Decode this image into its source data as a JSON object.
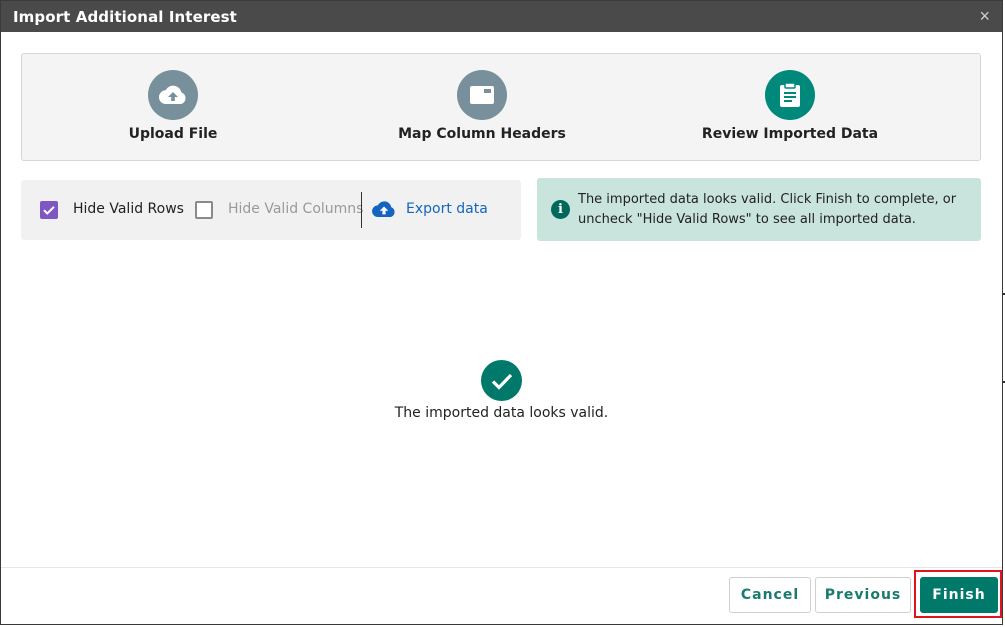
{
  "dialog": {
    "title": "Import Additional Interest",
    "close_label": "×"
  },
  "steps": [
    {
      "label": "Upload File",
      "icon": "cloud-upload-icon",
      "color": "#78909c"
    },
    {
      "label": "Map Column Headers",
      "icon": "window-icon",
      "color": "#78909c"
    },
    {
      "label": "Review Imported Data",
      "icon": "clipboard-icon",
      "color": "#00897b"
    }
  ],
  "toolbar": {
    "hide_valid_rows": {
      "label": "Hide Valid Rows",
      "checked": true
    },
    "hide_valid_columns": {
      "label": "Hide Valid Columns",
      "checked": false
    },
    "export": {
      "label": "Export data",
      "icon": "cloud-upload-icon"
    }
  },
  "info": {
    "icon": "info-icon",
    "text_line1": "The imported data looks valid. Click Finish to complete, or",
    "text_line2": "uncheck \"Hide Valid Rows\" to see all imported data."
  },
  "main": {
    "valid_icon": "check-circle-icon",
    "valid_message": "The imported data looks valid."
  },
  "footer": {
    "cancel_label": "Cancel",
    "previous_label": "Previous",
    "finish_label": "Finish"
  },
  "colors": {
    "accent": "#00796b",
    "checkbox": "#7e57c2",
    "highlight": "#e0141e"
  }
}
